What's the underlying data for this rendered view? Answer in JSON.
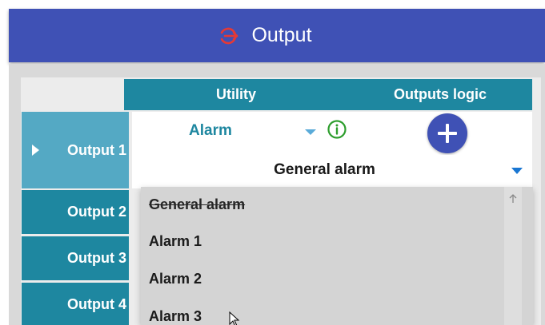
{
  "window": {
    "title": "Output",
    "title_icon": "power-output-icon"
  },
  "table": {
    "columns": [
      "Utility",
      "Outputs logic"
    ],
    "rows": [
      {
        "label": "Output 1",
        "selected": true
      },
      {
        "label": "Output 2",
        "selected": false
      },
      {
        "label": "Output 3",
        "selected": false
      },
      {
        "label": "Output 4",
        "selected": false
      }
    ]
  },
  "row1": {
    "utility_value": "Alarm",
    "info_icon": "info-circle-icon",
    "add_button_icon": "plus-icon",
    "alarm_type_value": "General alarm"
  },
  "dropdown": {
    "options": [
      {
        "label": "General alarm",
        "disabled": true
      },
      {
        "label": "Alarm 1",
        "disabled": false
      },
      {
        "label": "Alarm 2",
        "disabled": false
      },
      {
        "label": "Alarm 3",
        "disabled": false
      }
    ],
    "scroll_up_icon": "arrow-up-icon"
  },
  "colors": {
    "title_bar": "#3f51b5",
    "header_teal": "#1e87a0",
    "selected_row": "#54a9c4",
    "info_green": "#2e9e2e",
    "power_icon_red": "#e53935",
    "combo_caret": "#1976d2"
  }
}
